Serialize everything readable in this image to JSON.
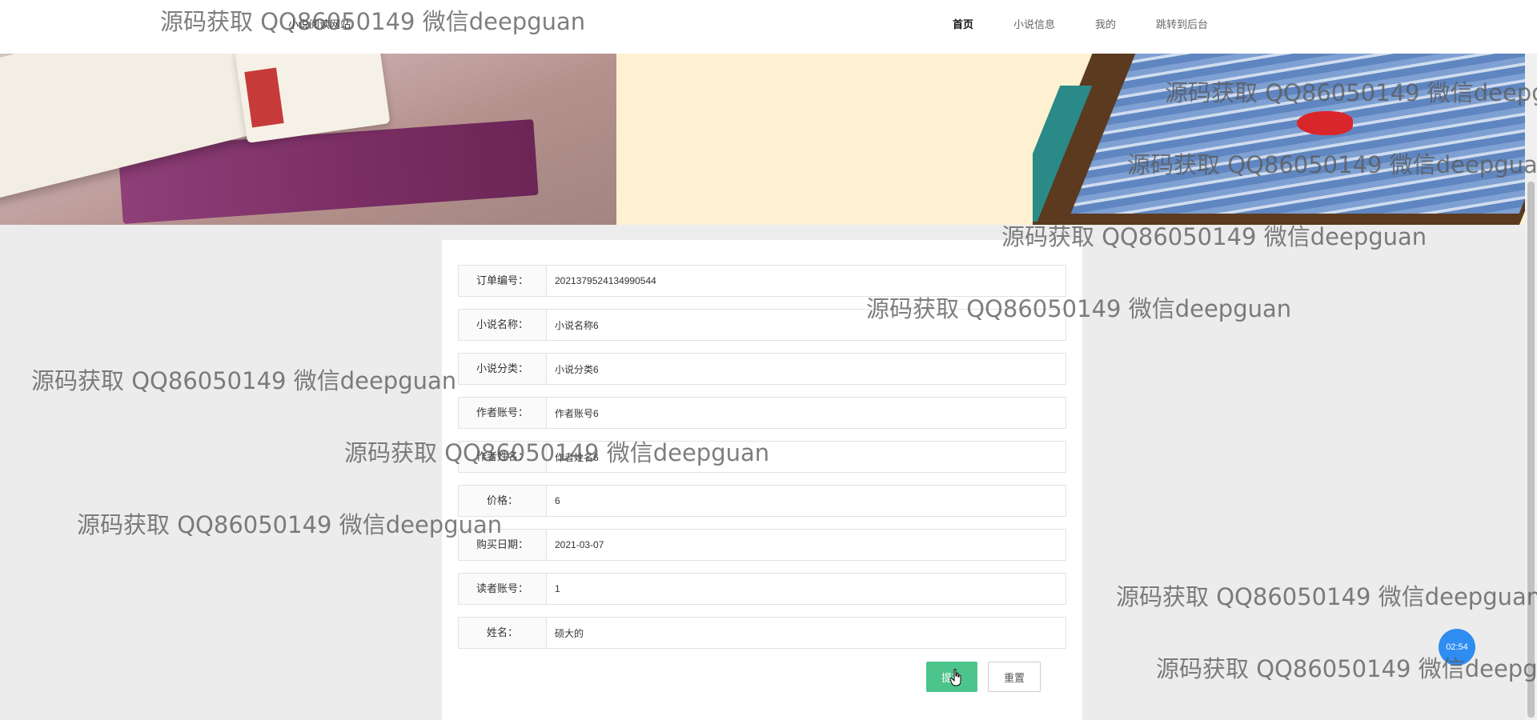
{
  "header": {
    "site_title": "小说阅读网站",
    "nav": [
      {
        "label": "首页",
        "active": true
      },
      {
        "label": "小说信息",
        "active": false
      },
      {
        "label": "我的",
        "active": false
      },
      {
        "label": "跳转到后台",
        "active": false
      }
    ]
  },
  "form": {
    "fields": [
      {
        "label": "订单编号：",
        "value": "2021379524134990544"
      },
      {
        "label": "小说名称：",
        "value": "小说名称6"
      },
      {
        "label": "小说分类：",
        "value": "小说分类6"
      },
      {
        "label": "作者账号：",
        "value": "作者账号6"
      },
      {
        "label": "作者姓名：",
        "value": "作者姓名6"
      },
      {
        "label": "价格：",
        "value": "6"
      },
      {
        "label": "购买日期：",
        "value": "2021-03-07"
      },
      {
        "label": "读者账号：",
        "value": "1"
      },
      {
        "label": "姓名：",
        "value": "硕大的"
      }
    ],
    "submit_label": "提交",
    "reset_label": "重置"
  },
  "timer": "02:54",
  "watermark": "源码获取 QQ86050149 微信deepguan",
  "colors": {
    "submit": "#4cc48b",
    "timer": "#2f8cf0",
    "page_background": "#ececec"
  },
  "icons": {
    "cursor": "hand-pointer-icon"
  }
}
